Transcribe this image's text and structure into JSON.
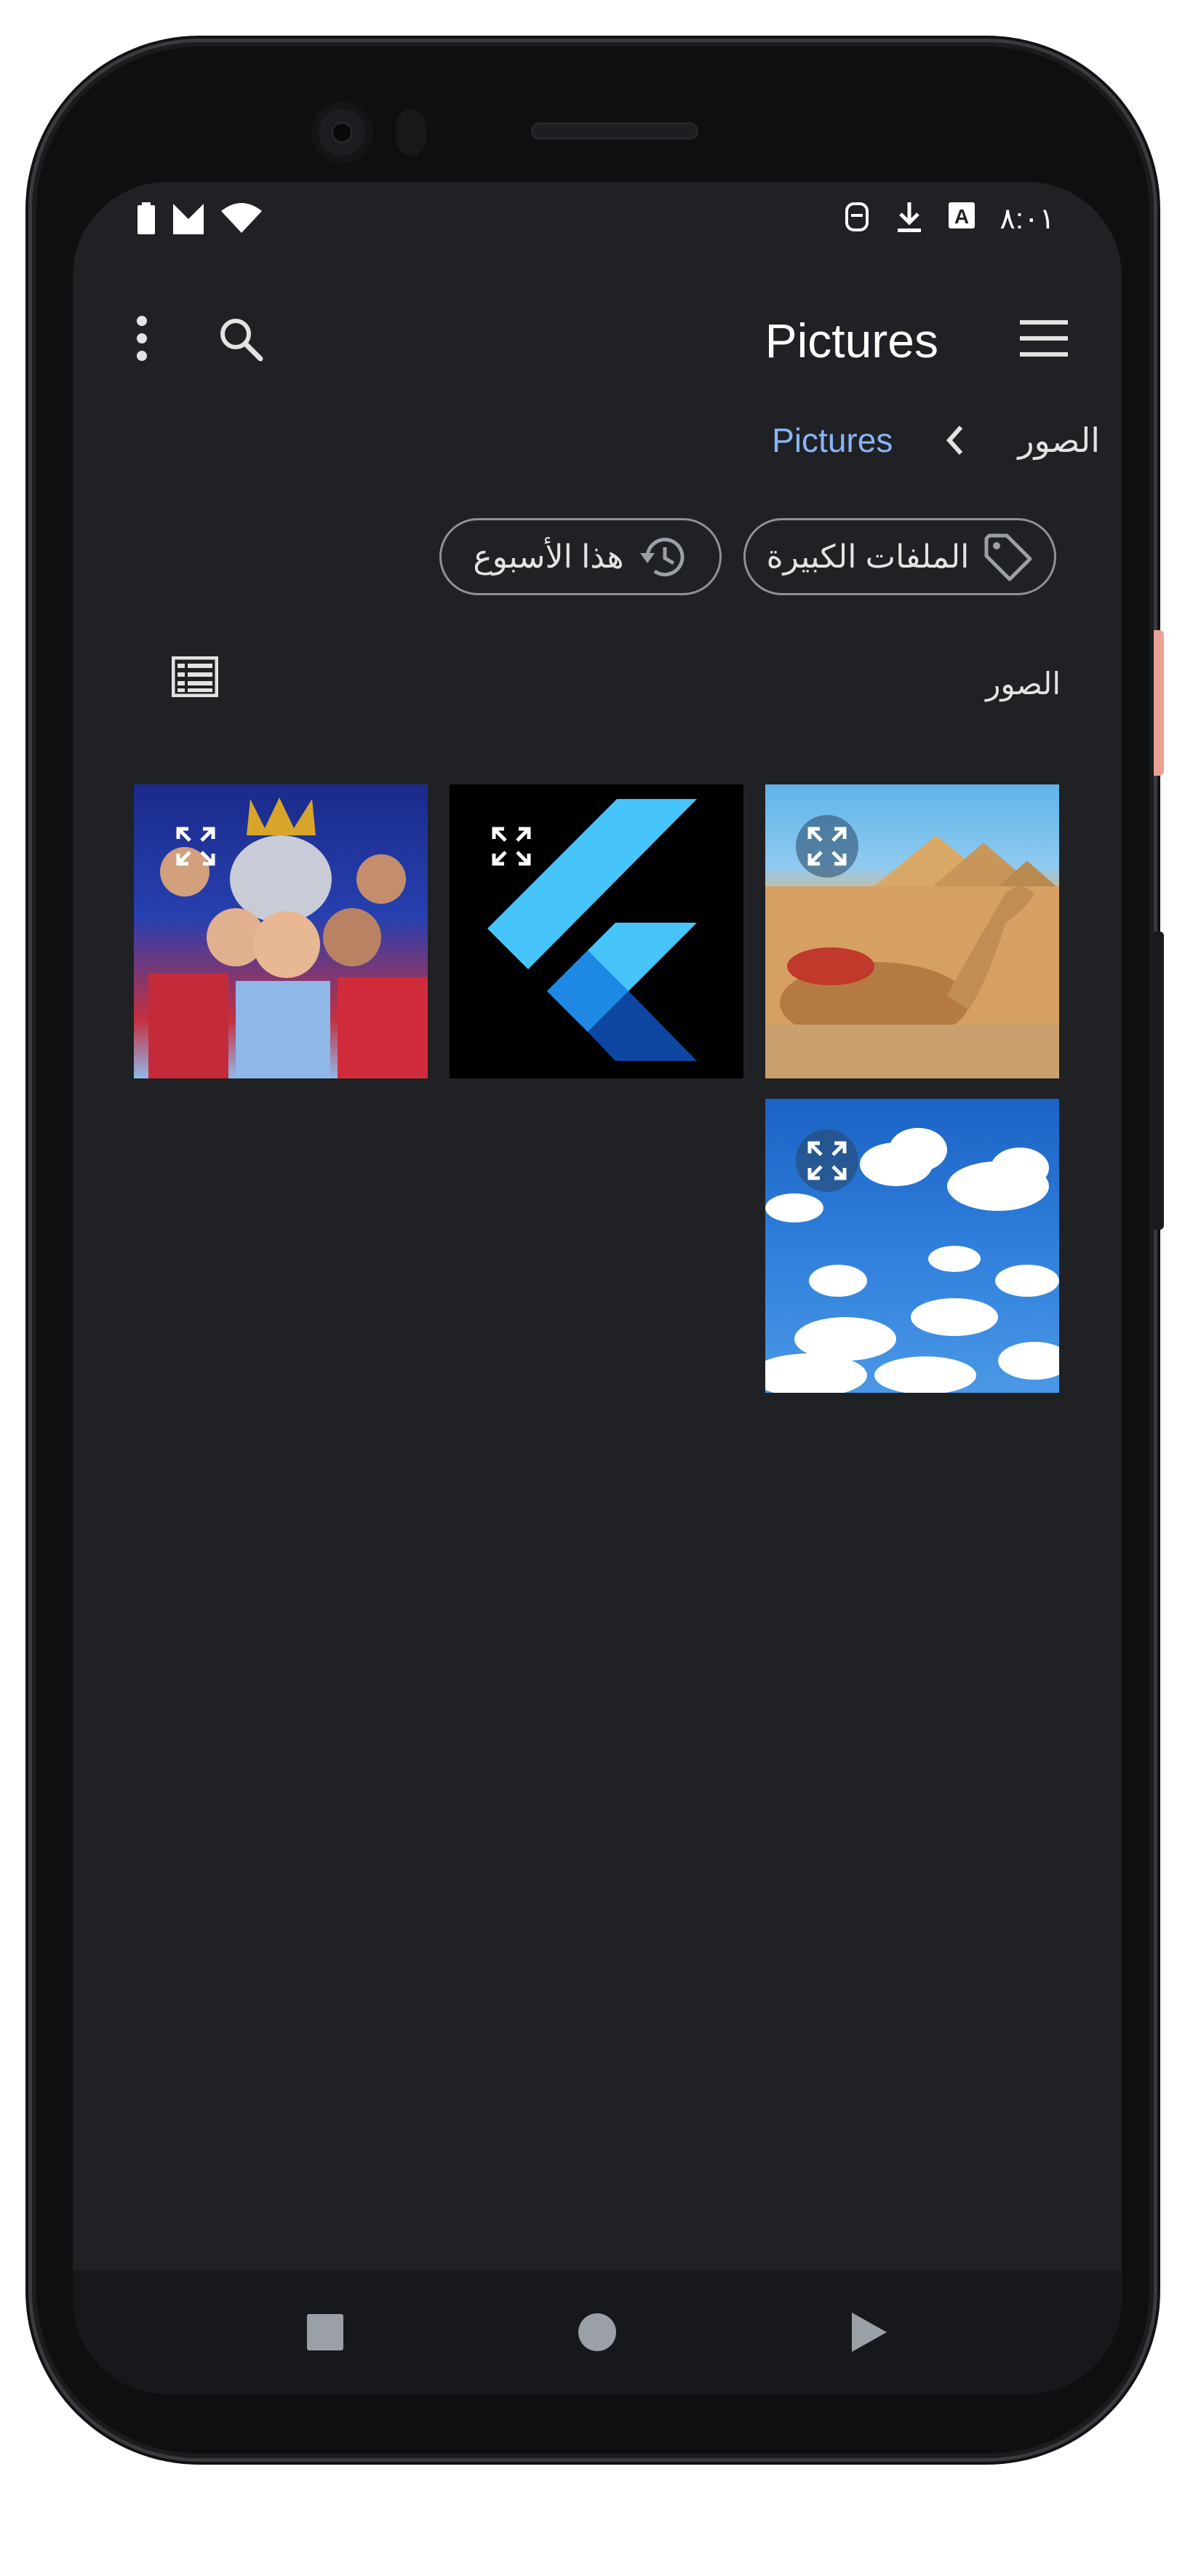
{
  "status_bar": {
    "time": "٨:٠١",
    "icons": [
      "battery-icon",
      "signal-icon",
      "wifi-icon",
      "sim-icon",
      "download-icon",
      "translate-icon"
    ]
  },
  "app_bar": {
    "title": "Pictures",
    "icons": [
      "more-vert-icon",
      "search-icon",
      "menu-icon"
    ]
  },
  "breadcrumb": {
    "root": "الصور",
    "current": "Pictures"
  },
  "chips": {
    "large_files": "الملفات الكبيرة",
    "this_week": "هذا الأسبوع"
  },
  "section": {
    "title": "الصور",
    "view_toggle_icon": "list-view-icon"
  },
  "images": [
    {
      "subject": "football-players-trophy",
      "icon": "expand-icon"
    },
    {
      "subject": "flutter-logo",
      "icon": "expand-icon"
    },
    {
      "subject": "pyramids-camel",
      "icon": "expand-icon"
    },
    {
      "subject": "sky-clouds",
      "icon": "expand-icon"
    }
  ],
  "colors": {
    "background": "#202124",
    "accent": "#8ab4f8",
    "text": "#e3e3e3"
  },
  "nav_bar": {
    "icons": [
      "recents-square-icon",
      "home-circle-icon",
      "back-triangle-icon"
    ]
  }
}
